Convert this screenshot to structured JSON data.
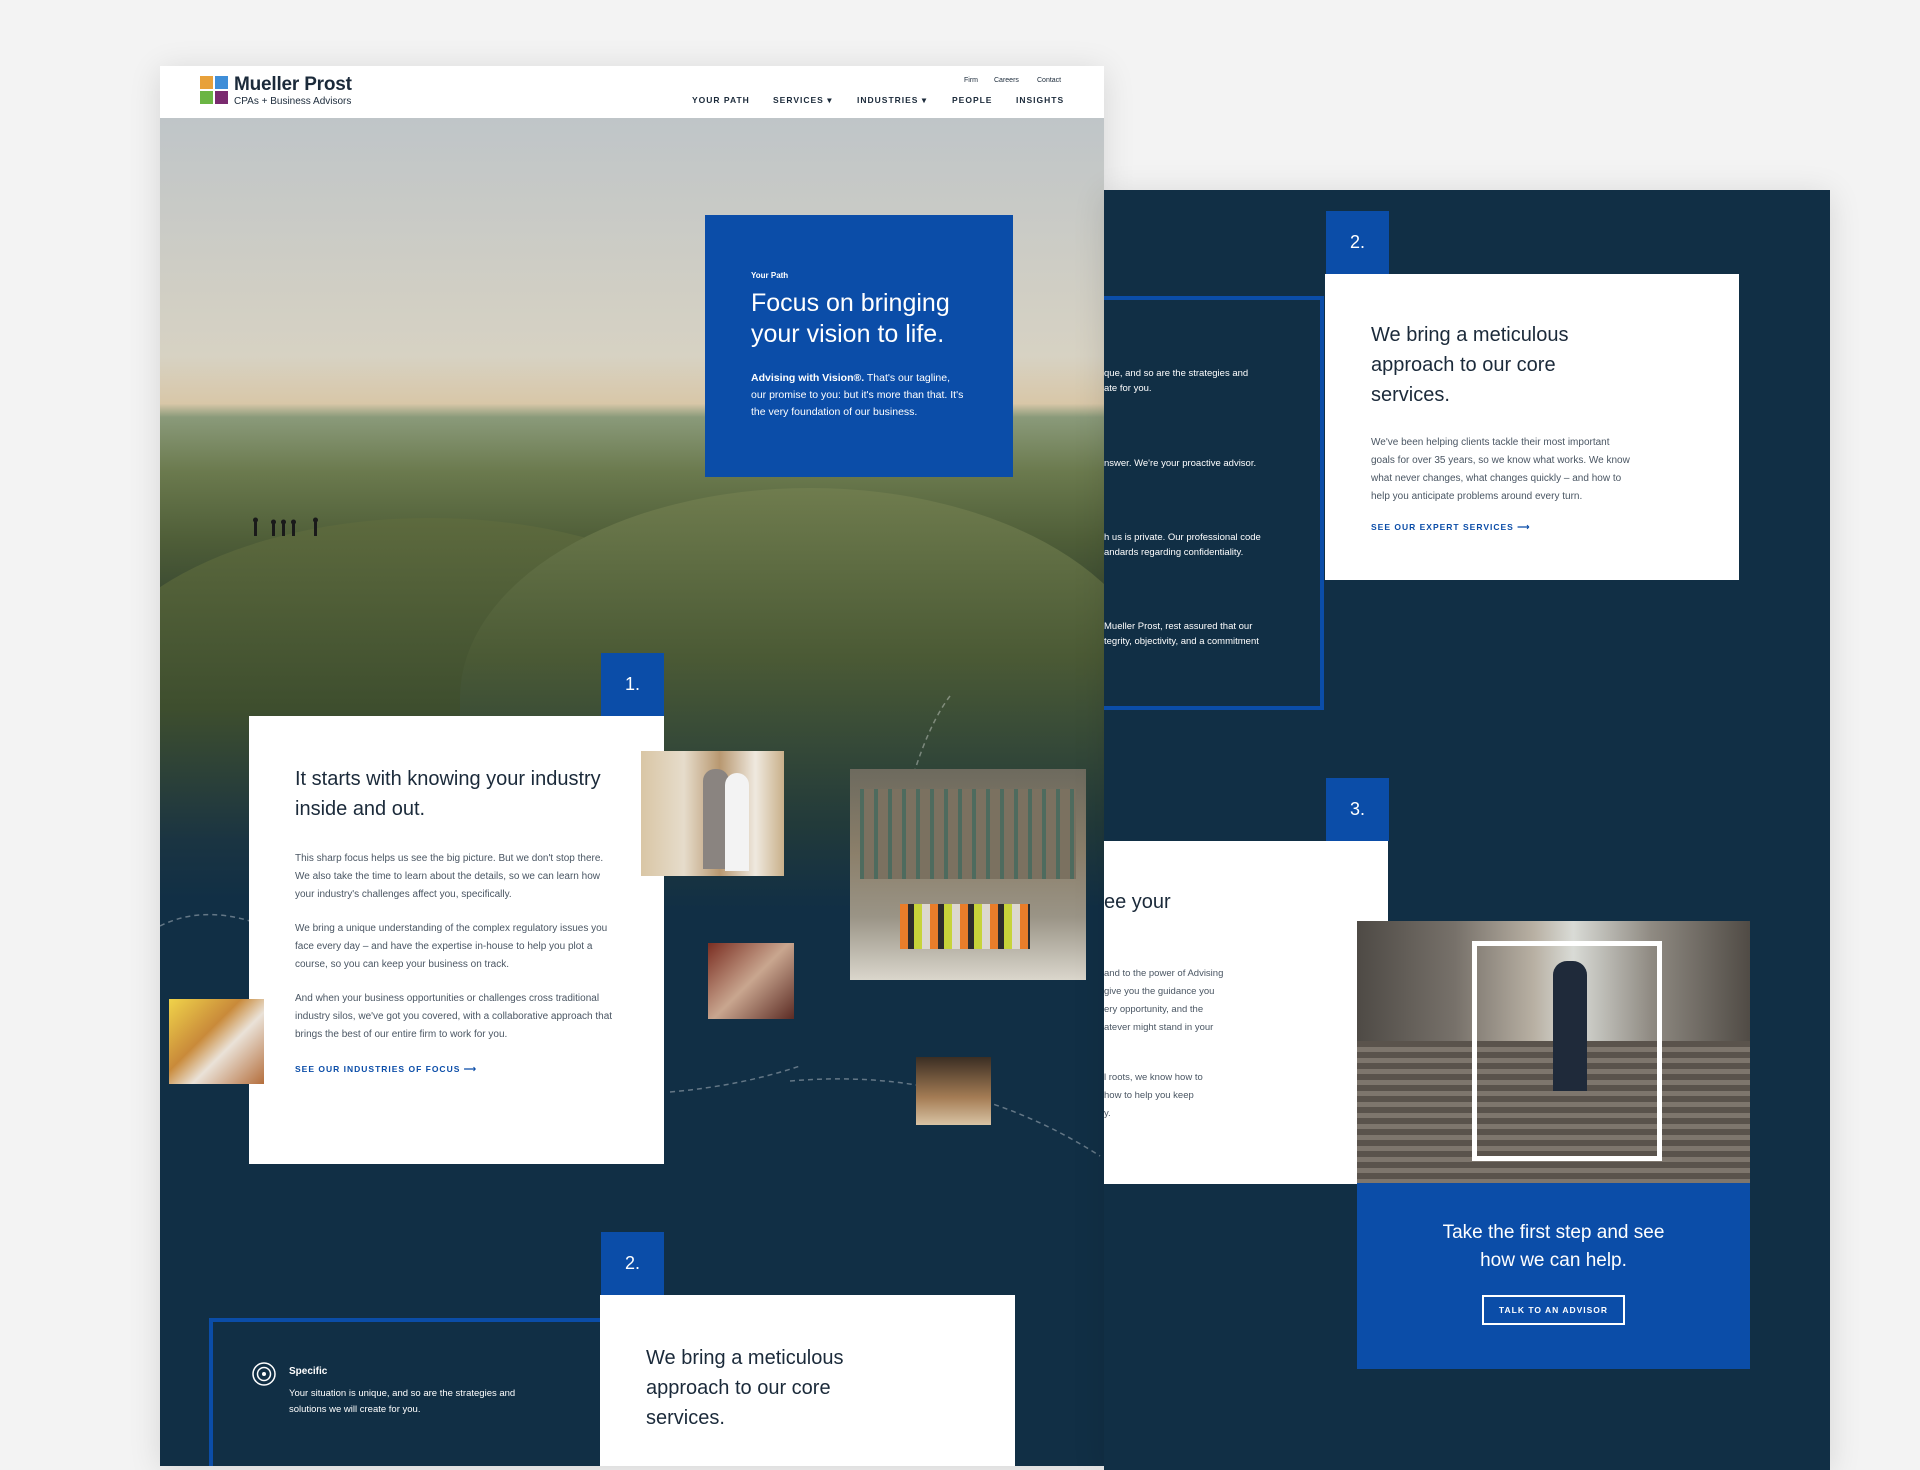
{
  "brand": {
    "name": "Mueller Prost",
    "tagline": "CPAs + Business Advisors",
    "logo_colors": [
      "#e8a13a",
      "#3f8ed8",
      "#6bb544",
      "#7a2a6f"
    ]
  },
  "util_nav": [
    "Firm",
    "Careers",
    "Contact"
  ],
  "main_nav": [
    {
      "label": "YOUR PATH"
    },
    {
      "label": "SERVICES",
      "caret": "▾"
    },
    {
      "label": "INDUSTRIES",
      "caret": "▾"
    },
    {
      "label": "PEOPLE"
    },
    {
      "label": "INSIGHTS"
    }
  ],
  "hero": {
    "eyebrow": "Your Path",
    "title": "Focus on bringing your vision to life.",
    "copy_bold": "Advising with Vision®.",
    "copy_rest": "That's our tagline, our promise to you: but it's more than that. It's the very foundation of our business."
  },
  "step1": {
    "number": "1.",
    "title": "It starts with knowing your industry inside and out.",
    "paragraphs": [
      "This sharp focus helps us see the big picture. But we don't stop there. We also take the time to learn about the details, so we can learn how your industry's challenges affect you, specifically.",
      "We bring a unique understanding of the complex regulatory issues you face every day – and have the expertise in-house to help you plot a course, so you can keep your business on track.",
      "And when your business opportunities or challenges cross traditional industry silos, we've got you covered, with a collaborative approach that brings the best of our entire firm to work for you."
    ],
    "link": "SEE OUR INDUSTRIES OF FOCUS",
    "arrow": "⟶"
  },
  "step2_left": {
    "number": "2.",
    "title": "We bring a meticulous approach to our core services.",
    "feature_title": "Specific",
    "feature_copy": "Your situation is unique, and so are the strategies and solutions we will create for you."
  },
  "step2_right": {
    "number": "2.",
    "title": "We bring a meticulous approach to our core services.",
    "body": "We've been helping clients tackle their most important goals for over 35 years, so we know what works. We know what never changes, what changes quickly – and how to help you anticipate problems around every turn.",
    "link": "SEE OUR EXPERT SERVICES",
    "arrow": "⟶",
    "partial_lines": [
      "que, and so are the strategies and",
      "ate for you.",
      "nswer. We're your proactive advisor.",
      "h us is private. Our professional code",
      "andards regarding confidentiality.",
      "Mueller Prost, rest assured that our",
      "tegrity, objectivity, and a commitment"
    ]
  },
  "step3": {
    "number": "3.",
    "partial_title": "ee your",
    "partial_lines": [
      "and to the power of Advising",
      "give you the guidance you",
      "ery opportunity, and the",
      "atever might stand in your",
      "l roots, we know how to",
      "how to help you keep",
      "y."
    ]
  },
  "cta": {
    "title": "Take the first step and see how we can help.",
    "button": "TALK TO AN ADVISOR"
  }
}
